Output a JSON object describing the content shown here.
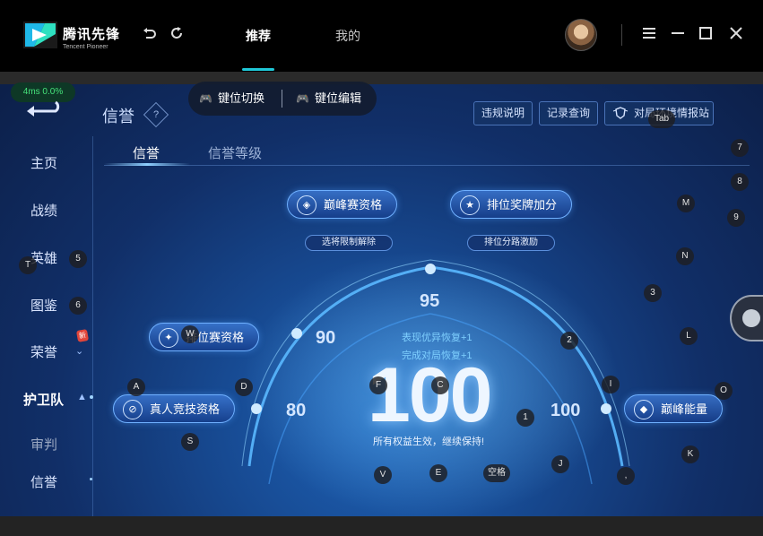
{
  "app": {
    "logo_cn": "腾讯先锋",
    "logo_en": "Tencent Pioneer",
    "tabs": [
      {
        "label": "推荐",
        "active": true
      },
      {
        "label": "我的",
        "active": false
      }
    ]
  },
  "perf": {
    "text": "4ms  0.0%"
  },
  "keybar": {
    "switch_label": "键位切换",
    "edit_label": "键位编辑"
  },
  "page": {
    "title": "信誉",
    "help_symbol": "?",
    "buttons": {
      "rules": "违规说明",
      "records": "记录查询",
      "report": "对局环境情报站"
    }
  },
  "sidebar": {
    "items": [
      {
        "label": "主页"
      },
      {
        "label": "战绩"
      },
      {
        "label": "英雄"
      },
      {
        "label": "图鉴"
      },
      {
        "label": "荣誉"
      },
      {
        "label": "护卫队"
      },
      {
        "label": "审判"
      },
      {
        "label": "信誉"
      }
    ],
    "new_badge": "新"
  },
  "subtabs": [
    {
      "label": "信誉",
      "active": true
    },
    {
      "label": "信誉等级",
      "active": false
    }
  ],
  "qualifications": {
    "peak": "巅峰赛资格",
    "rank_bonus": "排位奖牌加分",
    "ranked": "排位赛资格",
    "realname": "真人竞技资格",
    "peak_energy": "巅峰能量",
    "sub_hero_limit": "选将限制解除",
    "sub_lane_incentive": "排位分路激励"
  },
  "credit": {
    "score": "100",
    "thresholds": [
      "80",
      "90",
      "95",
      "100"
    ],
    "bonus_behavior": "表现优异恢复+1",
    "bonus_games": "完成对局恢复+1",
    "status": "所有权益生效，继续保持!"
  },
  "keyhints": {
    "tab": "Tab",
    "k7": "7",
    "k8": "8",
    "k9": "9",
    "m": "M",
    "t": "T",
    "k5": "5",
    "k6": "6",
    "n": "N",
    "k3": "3",
    "w": "W",
    "k2": "2",
    "l": "L",
    "a": "A",
    "d": "D",
    "f": "F",
    "c": "C",
    "i": "I",
    "o": "O",
    "k1": "1",
    "s": "S",
    "v": "V",
    "e": "E",
    "space": "空格",
    "j": "J",
    "comma": ",",
    "k": "K"
  },
  "colors": {
    "accent": "#1fc8d8",
    "panel_bg": "#174a92",
    "arc_glow": "#5ab8ff"
  }
}
